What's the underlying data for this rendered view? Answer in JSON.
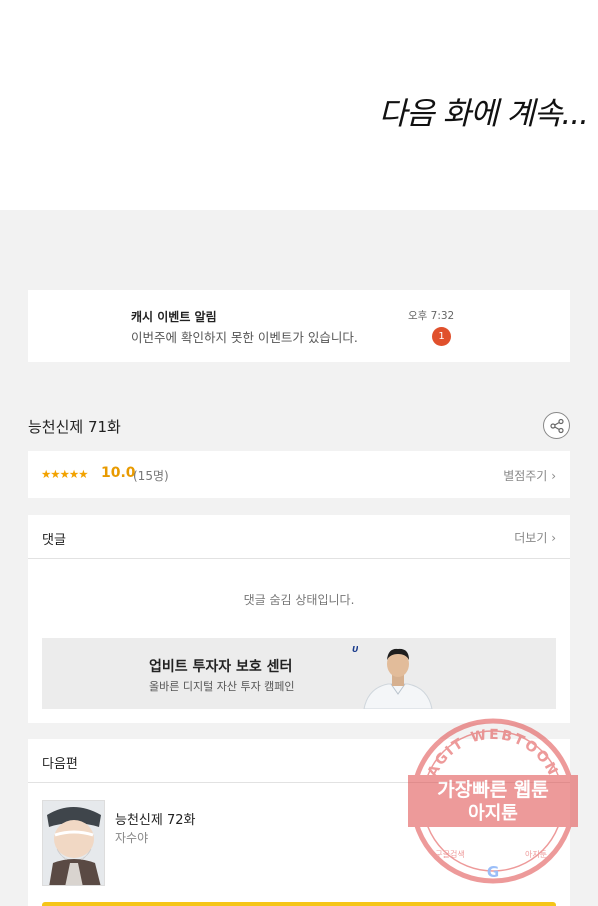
{
  "hero": {
    "text": "다음 화에 계속..."
  },
  "notification": {
    "title": "캐시 이벤트 알림",
    "message": "이번주에 확인하지 못한 이벤트가 있습니다.",
    "time": "오후 7:32",
    "badge": "1"
  },
  "episode": {
    "title": "능천신제 71화",
    "share_icon": "share-icon"
  },
  "rating": {
    "stars": "★★★★★",
    "score": "10.0",
    "votes": "(15명)",
    "rate_label": "별점주기"
  },
  "comments": {
    "title": "댓글",
    "more_label": "더보기",
    "hidden_message": "댓글 숨김 상태입니다."
  },
  "ad": {
    "title": "업비트 투자자 보호 센터",
    "subtitle": "올바른 디지털 자산 투자 캠페인",
    "logo": "UPbit"
  },
  "next_episode": {
    "section_title": "다음편",
    "title": "능천신제 72화",
    "author": "자수야"
  },
  "watermark": {
    "arc_text": "AGIT WEBTOON",
    "line1": "가장빠른 웹툰",
    "line2": "아지툰",
    "bottom_left": "구글검색",
    "bottom_right": "아지툰"
  },
  "colors": {
    "accent": "#f5c518",
    "badge": "#e0502c",
    "stars": "#f2a200",
    "stamp": "#e04848"
  }
}
